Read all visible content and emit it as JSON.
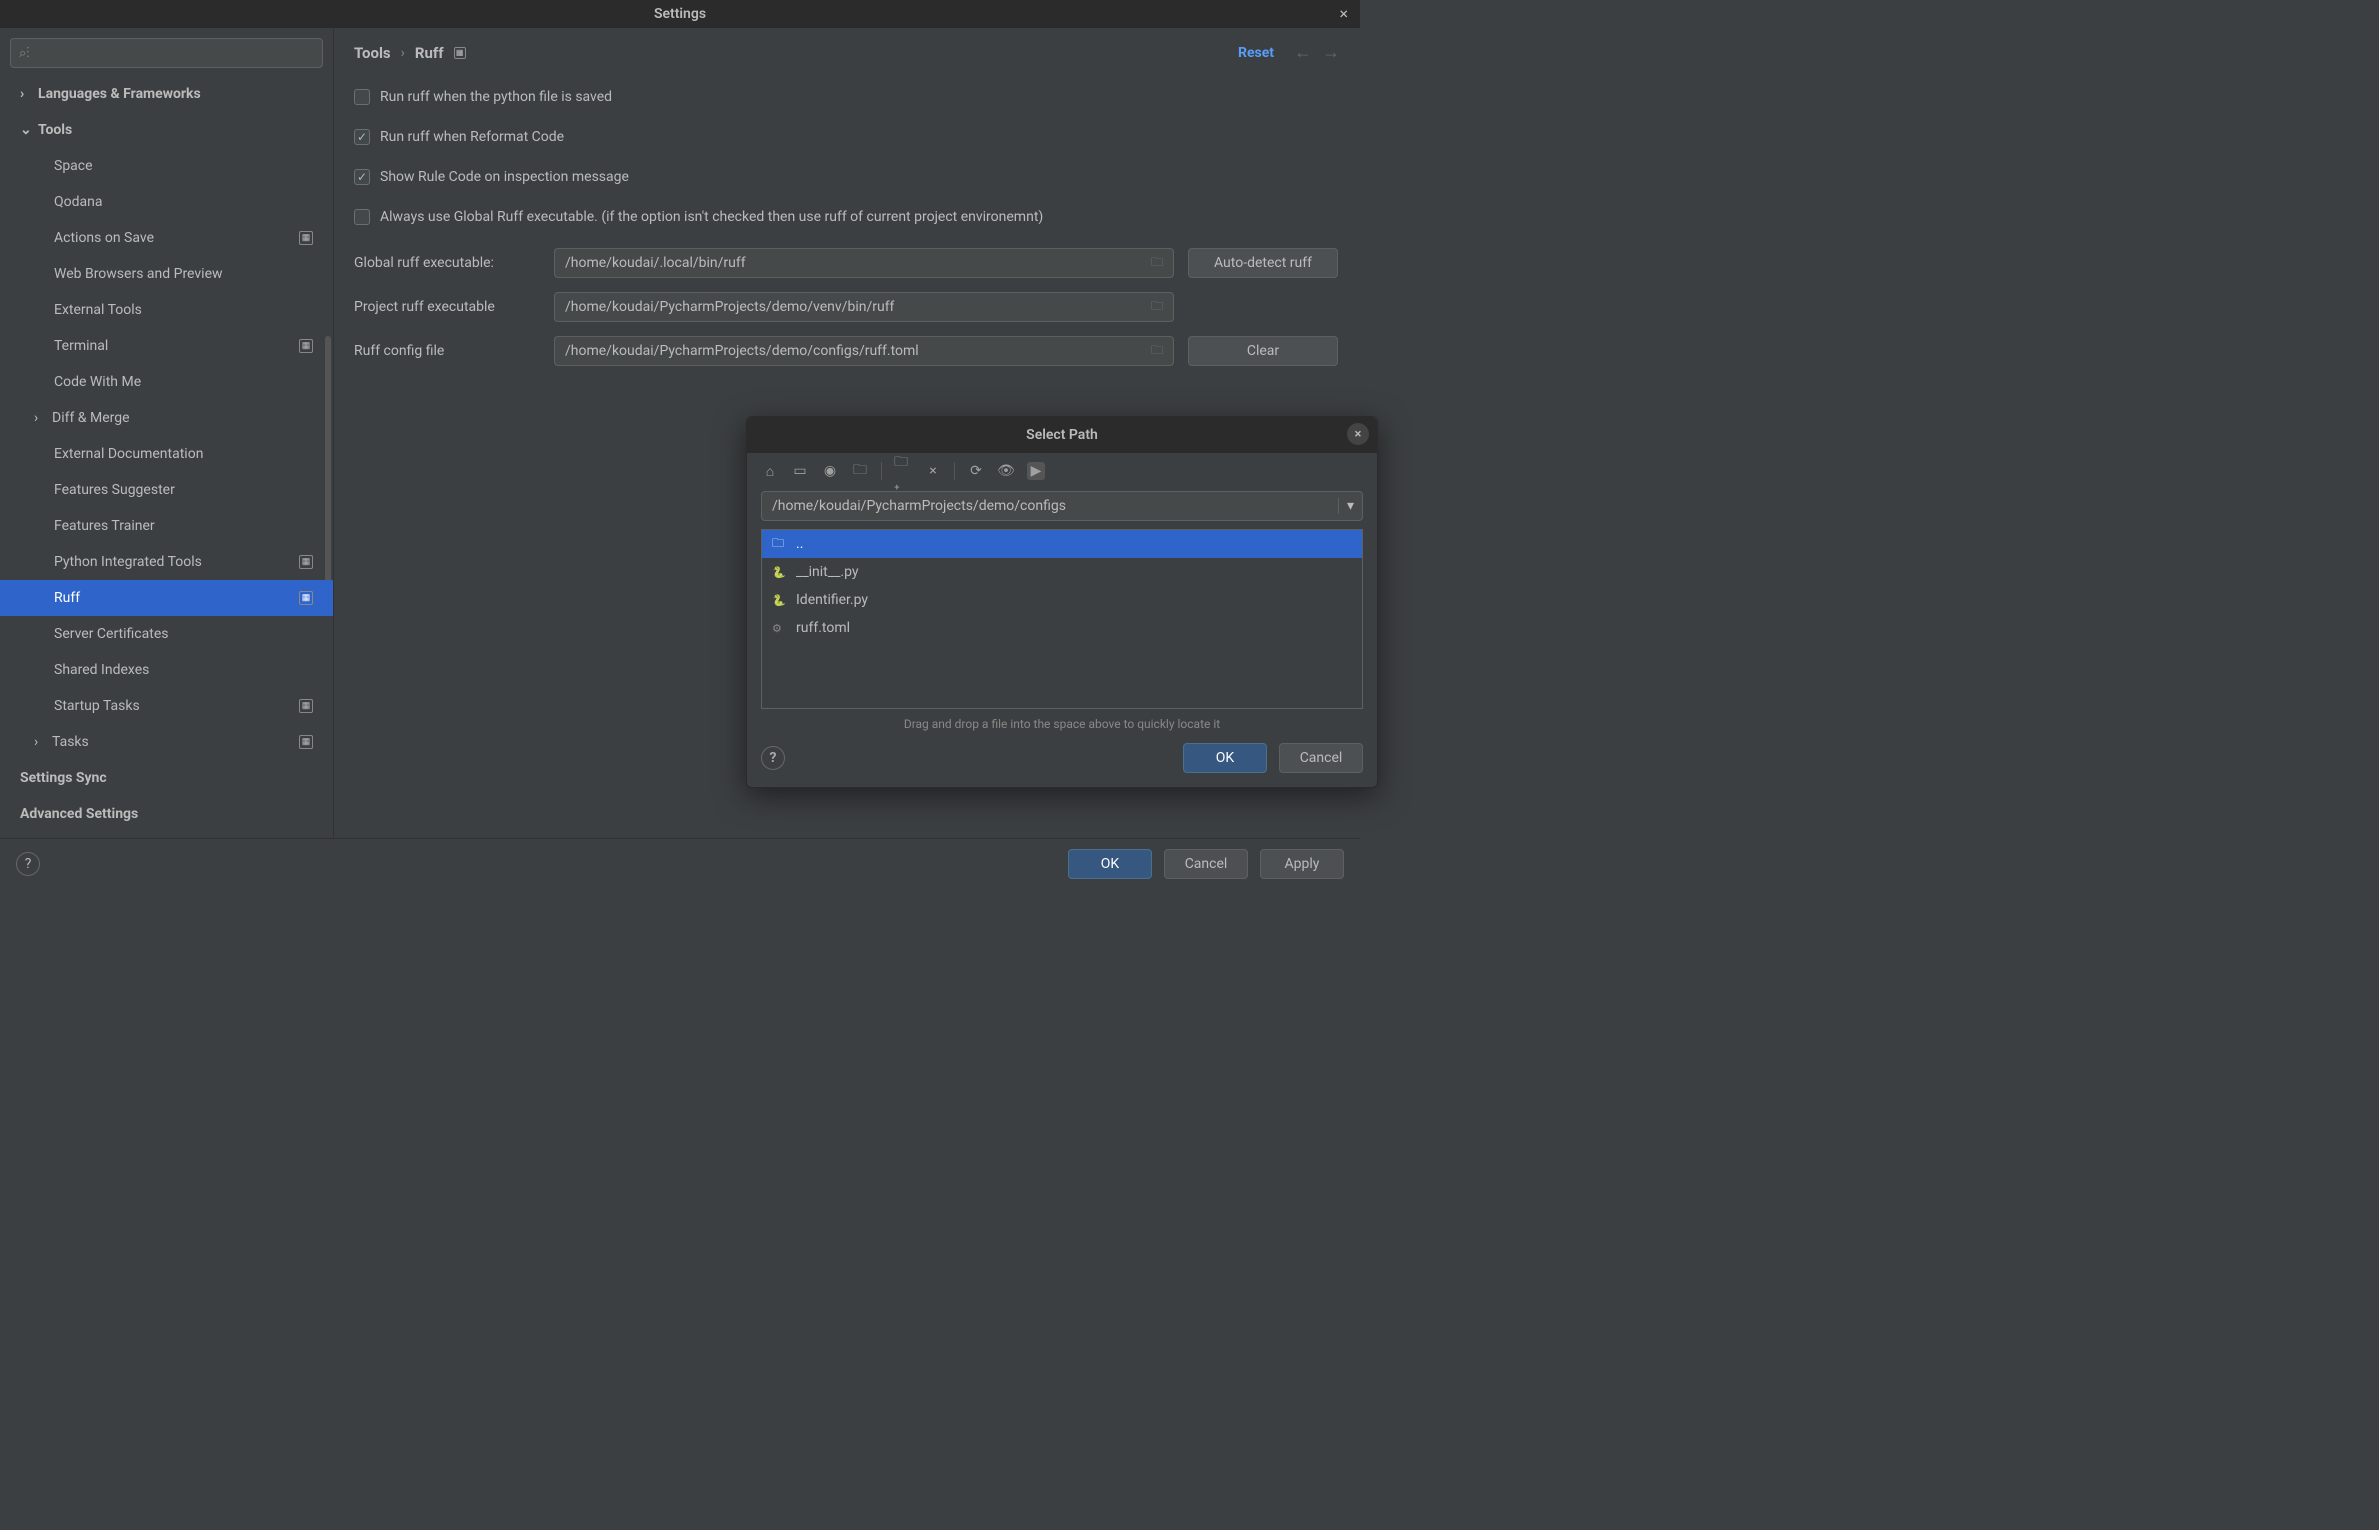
{
  "window": {
    "title": "Settings"
  },
  "sidebar": {
    "search_placeholder": "",
    "items": [
      {
        "label": "Languages & Frameworks",
        "chev": "›",
        "bold": true,
        "lvl": "lvl1"
      },
      {
        "label": "Tools",
        "chev": "⌄",
        "bold": true,
        "lvl": "lvl1"
      },
      {
        "label": "Space",
        "lvl": "lvl2"
      },
      {
        "label": "Qodana",
        "lvl": "lvl2"
      },
      {
        "label": "Actions on Save",
        "lvl": "lvl2",
        "badge": true
      },
      {
        "label": "Web Browsers and Preview",
        "lvl": "lvl2"
      },
      {
        "label": "External Tools",
        "lvl": "lvl2"
      },
      {
        "label": "Terminal",
        "lvl": "lvl2",
        "badge": true
      },
      {
        "label": "Code With Me",
        "lvl": "lvl2"
      },
      {
        "label": "Diff & Merge",
        "lvl": "lvl2c",
        "chev": "›"
      },
      {
        "label": "External Documentation",
        "lvl": "lvl2"
      },
      {
        "label": "Features Suggester",
        "lvl": "lvl2"
      },
      {
        "label": "Features Trainer",
        "lvl": "lvl2"
      },
      {
        "label": "Python Integrated Tools",
        "lvl": "lvl2",
        "badge": true
      },
      {
        "label": "Ruff",
        "lvl": "lvl2",
        "badge": true,
        "selected": true
      },
      {
        "label": "Server Certificates",
        "lvl": "lvl2"
      },
      {
        "label": "Shared Indexes",
        "lvl": "lvl2"
      },
      {
        "label": "Startup Tasks",
        "lvl": "lvl2",
        "badge": true
      },
      {
        "label": "Tasks",
        "lvl": "lvl2c",
        "chev": "›",
        "badge": true
      },
      {
        "label": "Settings Sync",
        "bold": true,
        "lvl": "lvl1"
      },
      {
        "label": "Advanced Settings",
        "bold": true,
        "lvl": "lvl1"
      }
    ]
  },
  "breadcrumb": {
    "root": "Tools",
    "leaf": "Ruff",
    "reset": "Reset"
  },
  "options": {
    "run_on_save": {
      "label": "Run ruff when the python file is saved",
      "checked": false
    },
    "run_on_reformat": {
      "label": "Run ruff when Reformat Code",
      "checked": true
    },
    "show_rule_code": {
      "label": "Show Rule Code on inspection message",
      "checked": true
    },
    "always_global": {
      "label": "Always use Global Ruff executable. (if the option isn't checked then use ruff of current project environemnt)",
      "checked": false
    }
  },
  "fields": {
    "global_exec": {
      "label": "Global ruff executable:",
      "value": "/home/koudai/.local/bin/ruff",
      "btn": "Auto-detect ruff"
    },
    "project_exec": {
      "label": "Project ruff executable",
      "value": "/home/koudai/PycharmProjects/demo/venv/bin/ruff"
    },
    "config": {
      "label": "Ruff config file",
      "value": "/home/koudai/PycharmProjects/demo/configs/ruff.toml",
      "btn": "Clear"
    }
  },
  "dialog": {
    "title": "Select Path",
    "path": "/home/koudai/PycharmProjects/demo/configs",
    "files": [
      {
        "name": "..",
        "type": "dir",
        "selected": true
      },
      {
        "name": "__init__.py",
        "type": "py"
      },
      {
        "name": "Identifier.py",
        "type": "py"
      },
      {
        "name": "ruff.toml",
        "type": "toml"
      }
    ],
    "hint": "Drag and drop a file into the space above to quickly locate it",
    "ok": "OK",
    "cancel": "Cancel"
  },
  "footer": {
    "ok": "OK",
    "cancel": "Cancel",
    "apply": "Apply"
  }
}
